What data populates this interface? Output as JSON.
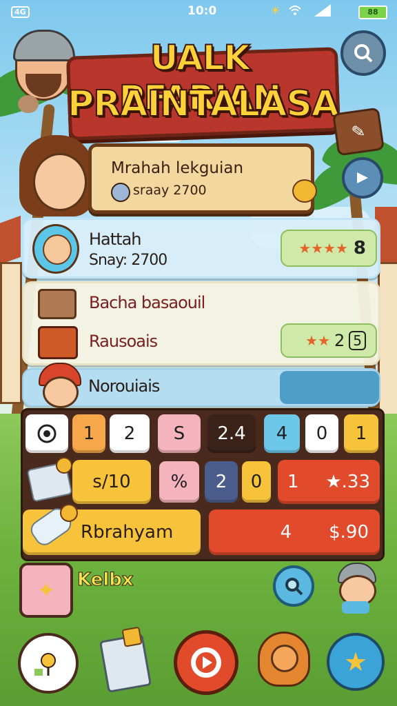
{
  "status_bar": {
    "left_badge": "4G",
    "time": "10:0",
    "icons": [
      "sun-icon",
      "wifi-icon",
      "signal-icon",
      "battery-icon"
    ],
    "battery_label": "88"
  },
  "banner": {
    "line1": "UALK PFARIAN",
    "line2": "PRAINTALASA"
  },
  "top_buttons": {
    "search_icon": "magnifier-icon",
    "shop_icon": "cart-icon",
    "next_icon": "arrow-right-icon"
  },
  "sign": {
    "title": "Mrahah lekguian",
    "subtitle": "sraay  2700"
  },
  "player_card": {
    "name": "Hattah",
    "score_label": "Snay:  2700",
    "stars_value": "8"
  },
  "item_card": {
    "item1": "Bacha basaouil",
    "item2": "Rausoais",
    "count_value": "2",
    "count_badge": "5"
  },
  "teammate_card": {
    "name": "Norouiais"
  },
  "grid": {
    "row1": [
      "1",
      "2",
      "S",
      "2.4",
      "4",
      "0",
      "1"
    ],
    "row2": {
      "price": "s/10",
      "cells": [
        "%",
        "2",
        "0",
        "1"
      ],
      "price_right": "★.33"
    },
    "row3": {
      "label": "Rbrahyam",
      "value": "4",
      "price": "$.90"
    }
  },
  "bottom_area": {
    "badge_text": "Kelbx",
    "nav": [
      "map-icon",
      "bag-icon",
      "record-button-icon",
      "lion-icon",
      "star-bell-icon"
    ]
  },
  "colors": {
    "banner_red": "#b8362b",
    "banner_yellow": "#ffd23a",
    "board_brown": "#4a2a1c",
    "accent_red": "#e24a2c",
    "accent_yellow": "#f7c33a",
    "accent_blue": "#5bb8e0"
  }
}
